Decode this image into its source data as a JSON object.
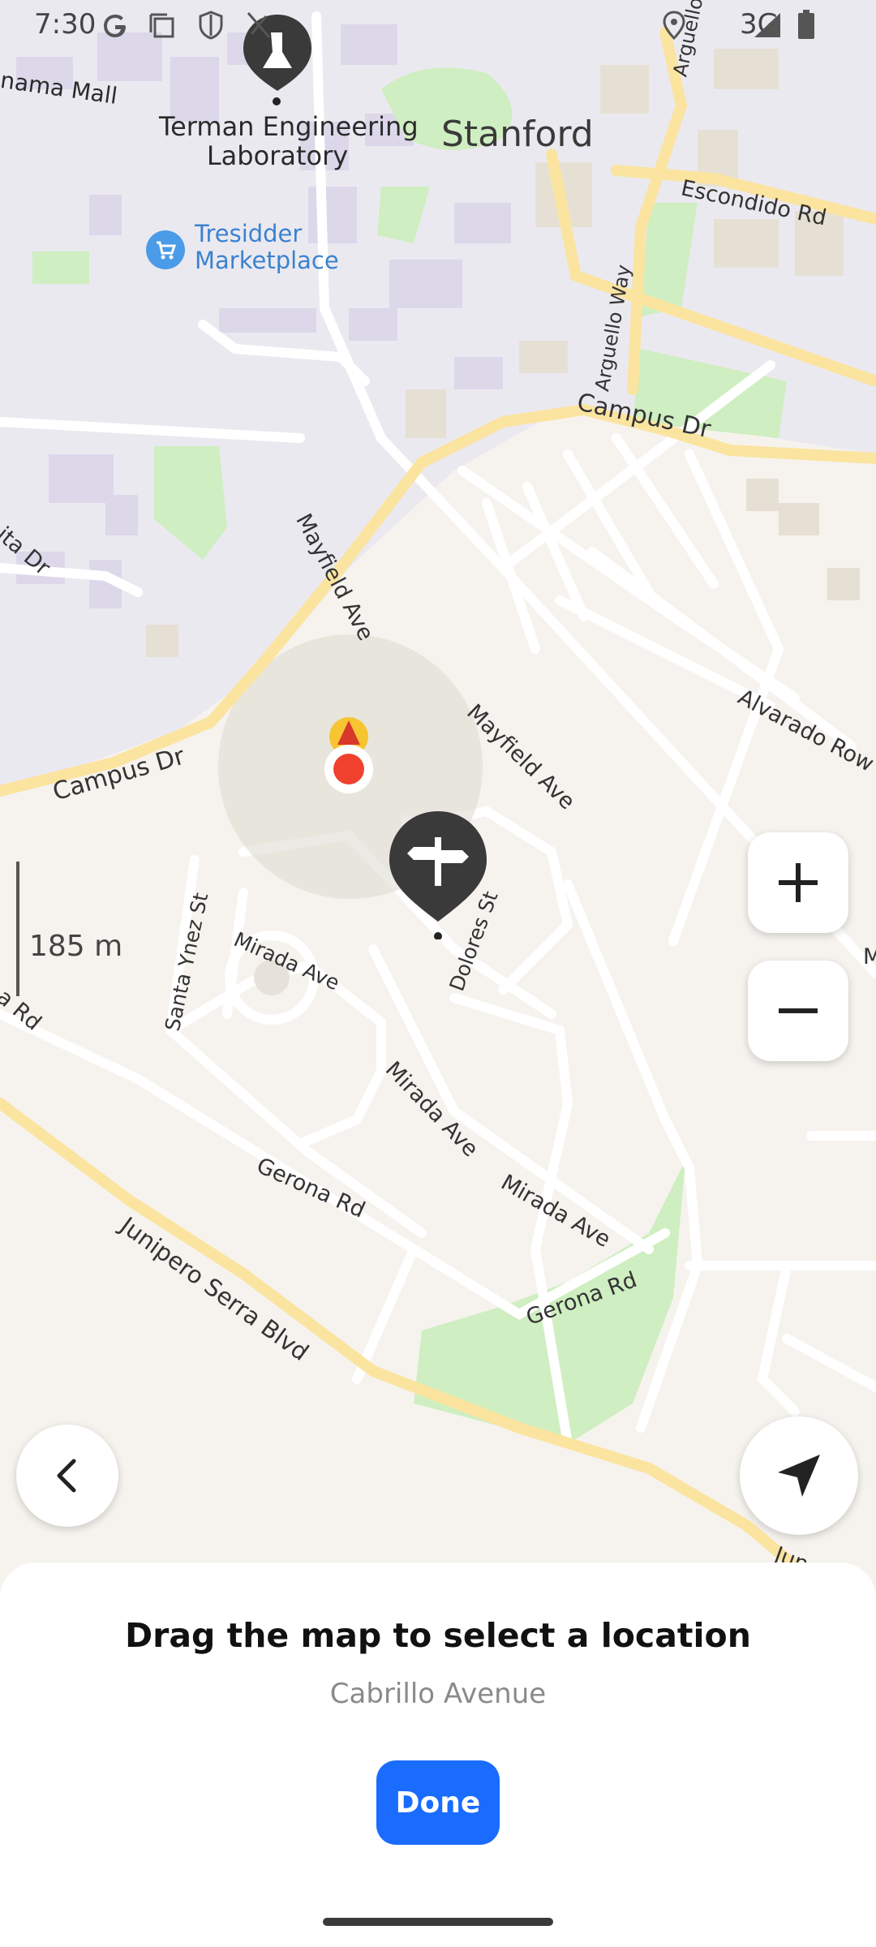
{
  "status_bar": {
    "time": "7:30",
    "network": "3G"
  },
  "map": {
    "poi": {
      "terman_line1": "Terman Engineering",
      "terman_line2": "Laboratory",
      "stanford": "Stanford",
      "tresidder_line1": "Tresidder",
      "tresidder_line2": "Marketplace",
      "partial_top_left": "nama Mall"
    },
    "streets": {
      "escondido": "Escondido Rd",
      "arguello_way": "Arguello Way",
      "arguello_top": "Arguello",
      "campus_dr_top": "Campus Dr",
      "campus_dr_left": "Campus Dr",
      "mayfield_1": "Mayfield Ave",
      "mayfield_2": "Mayfield Ave",
      "alvarado": "Alvarado Row",
      "santa_ynez": "Santa Ynez St",
      "mirada_1": "Mirada Ave",
      "mirada_2": "Mirada Ave",
      "mirada_3": "Mirada Ave",
      "dolores": "Dolores St",
      "gerona_1": "Gerona Rd",
      "gerona_2": "Gerona Rd",
      "junipero": "Junipero Serra Blvd",
      "partial_ita": "ita Dr",
      "partial_rd": "a Rd",
      "partial_m": "M",
      "partial_jun": "Jun"
    },
    "scale_label": "185 m",
    "colors": {
      "campus_block": "#e8e6ee",
      "residential": "#f6f3ee",
      "park": "#cfeec1",
      "major_road": "#fbe59a",
      "building": "#d9d5e6"
    }
  },
  "controls": {
    "zoom_in_icon": "plus-icon",
    "zoom_out_icon": "minus-icon",
    "back_icon": "chevron-left-icon",
    "locate_icon": "navigation-arrow-icon"
  },
  "sheet": {
    "title": "Drag the map to select a location",
    "subtitle": "Cabrillo Avenue",
    "done_label": "Done"
  },
  "accent_color": "#1a6cff"
}
